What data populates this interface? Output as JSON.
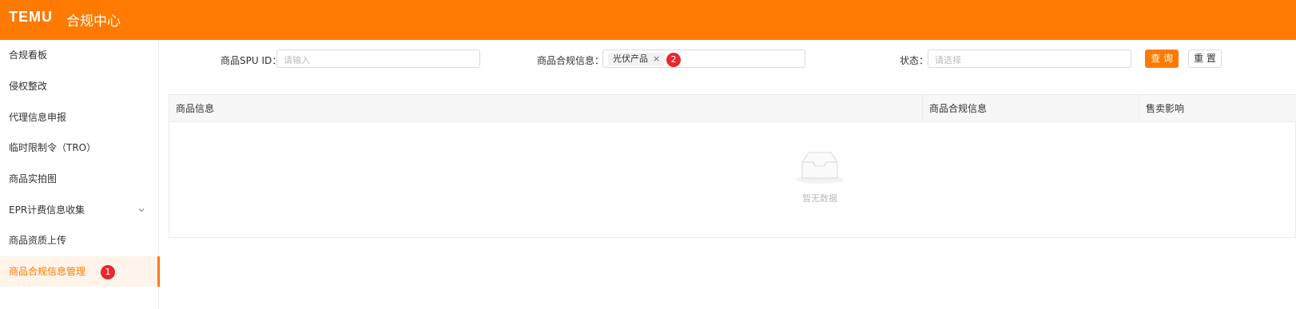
{
  "header": {
    "logo": "TEMU",
    "title": "合规中心"
  },
  "sidebar": {
    "items": [
      {
        "label": "合规看板"
      },
      {
        "label": "侵权整改"
      },
      {
        "label": "代理信息申报"
      },
      {
        "label": "临时限制令（TRO）"
      },
      {
        "label": "商品实拍图"
      },
      {
        "label": "EPR计费信息收集"
      },
      {
        "label": "商品资质上传"
      },
      {
        "label": "商品合规信息管理",
        "active": true
      }
    ]
  },
  "annotations": {
    "marker1": "1",
    "marker2": "2"
  },
  "filters": {
    "spu": {
      "label": "商品SPU ID：",
      "placeholder": "请输入"
    },
    "compliance": {
      "label": "商品合规信息：",
      "tag": "光伏产品",
      "tag_close": "×"
    },
    "status": {
      "label": "状态：",
      "placeholder": "请选择"
    }
  },
  "buttons": {
    "query": "查 询",
    "reset": "重 置"
  },
  "table": {
    "columns": [
      "商品信息",
      "商品合规信息",
      "售卖影响"
    ],
    "empty_text": "暂无数据"
  },
  "colors": {
    "brand": "#ff7a00",
    "badge": "#e8282d"
  },
  "icons": {
    "chevron": "chevron-down-icon",
    "empty": "empty-inbox-icon",
    "close": "close-icon"
  }
}
